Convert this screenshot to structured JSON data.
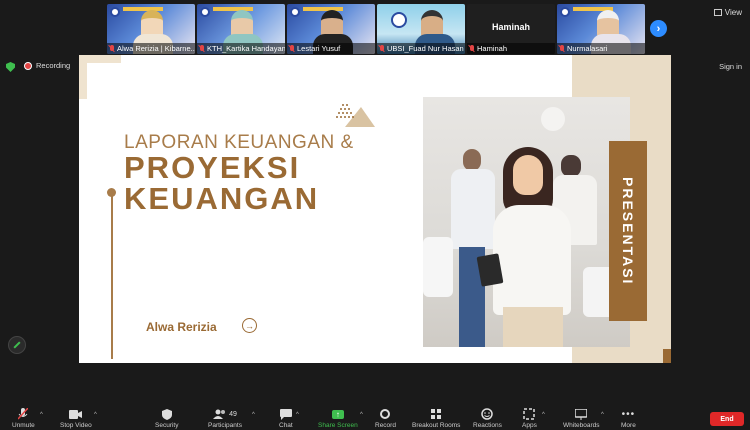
{
  "gallery": {
    "tiles": [
      {
        "name": "Alwa Rerizia | Kibarne...",
        "muted": true
      },
      {
        "name": "KTH_Kartika Handayani",
        "muted": true
      },
      {
        "name": "Lestari Yusuf",
        "muted": true
      },
      {
        "name": "UBSI_Fuad Nur Hasan",
        "muted": true
      },
      {
        "name": "Haminah",
        "display": "Haminah",
        "muted": true
      },
      {
        "name": "Nurmalasari",
        "muted": true
      }
    ],
    "next_label": "›"
  },
  "top": {
    "view_label": "View",
    "recording_label": "Recording",
    "signin_label": "Sign in"
  },
  "slide": {
    "title_small": "LAPORAN KEUANGAN &",
    "title_big_line1": "PROYEKSI",
    "title_big_line2": "KEUANGAN",
    "presenter": "Alwa Rerizia",
    "side_label": "PRESENTASI"
  },
  "toolbar": {
    "unmute": "Unmute",
    "stop_video": "Stop Video",
    "security": "Security",
    "participants": "Participants",
    "participants_count": "49",
    "chat": "Chat",
    "share_screen": "Share Screen",
    "record": "Record",
    "breakout_rooms": "Breakout Rooms",
    "reactions": "Reactions",
    "apps": "Apps",
    "whiteboards": "Whiteboards",
    "more": "More",
    "end": "End"
  },
  "colors": {
    "accent_brown": "#9a6a34",
    "beige": "#e9dcc6",
    "zoom_blue": "#2d8cff",
    "end_red": "#e02828",
    "share_green": "#3fbf4f"
  }
}
